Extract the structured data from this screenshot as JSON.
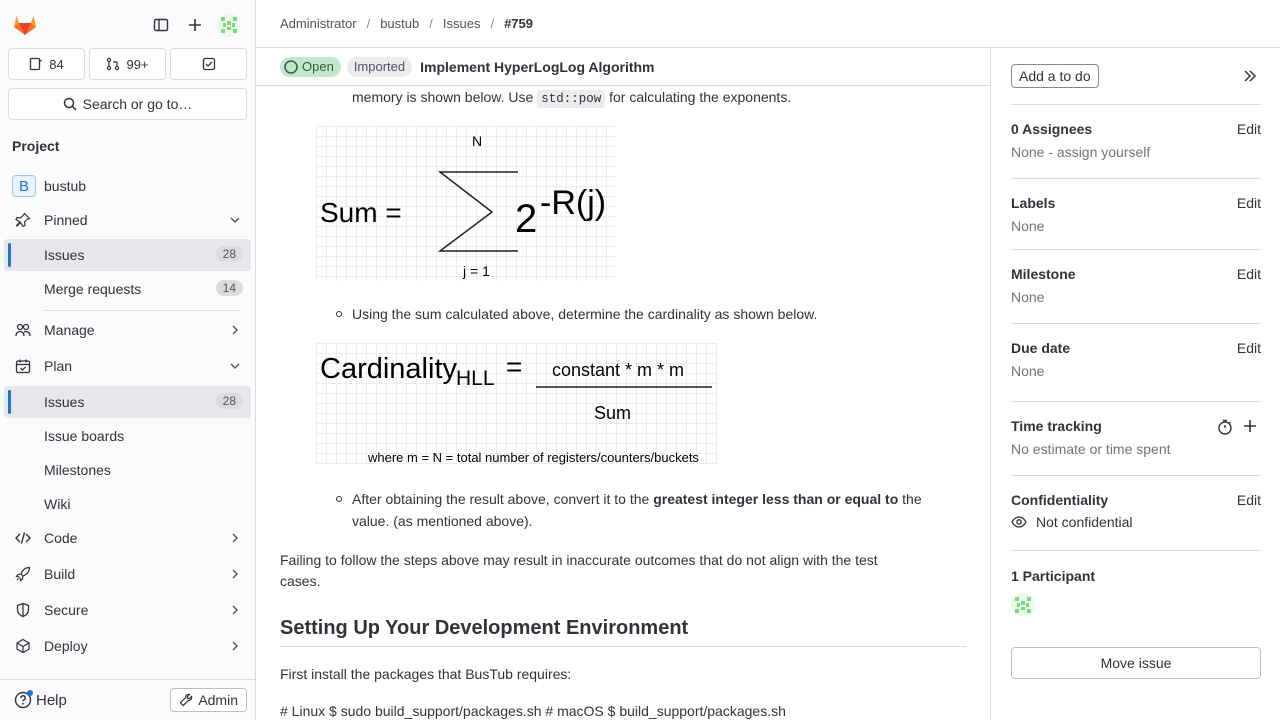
{
  "sidebar": {
    "counters": {
      "issues": "84",
      "merge_requests": "99+"
    },
    "search_label": "Search or go to…",
    "section_label": "Project",
    "project_initial": "B",
    "project_name": "bustub",
    "pinned_label": "Pinned",
    "pinned_items": [
      {
        "label": "Issues",
        "count": "28"
      },
      {
        "label": "Merge requests",
        "count": "14"
      }
    ],
    "manage_label": "Manage",
    "plan_label": "Plan",
    "plan_items": [
      {
        "label": "Issues",
        "count": "28"
      },
      {
        "label": "Issue boards"
      },
      {
        "label": "Milestones"
      },
      {
        "label": "Wiki"
      }
    ],
    "groups": [
      "Code",
      "Build",
      "Secure",
      "Deploy"
    ],
    "help_label": "Help",
    "admin_label": "Admin"
  },
  "breadcrumb": [
    "Administrator",
    "bustub",
    "Issues",
    "#759"
  ],
  "issue": {
    "status": "Open",
    "imported": "Imported",
    "title": "Implement HyperLogLog Algorithm"
  },
  "content": {
    "p1_pre": "memory is shown below. Use ",
    "p1_code": "std::pow",
    "p1_post": " for calculating the exponents.",
    "formula1": {
      "lhs": "Sum =",
      "top": "N",
      "bottom": "j = 1",
      "base": "2",
      "exp": "-R(j)"
    },
    "bullet1": "Using the sum calculated above, determine the cardinality as shown below.",
    "formula2": {
      "lhs": "Cardinality",
      "sub": "HLL",
      "eq": "=",
      "num": "constant * m * m",
      "den": "Sum",
      "note": "where m = N = total number of registers/counters/buckets"
    },
    "bullet2_pre": "After obtaining the result above, convert it to the ",
    "bullet2_bold": "greatest integer less than or equal to",
    "bullet2_post": " the",
    "bullet2_line2": "value. (as mentioned above).",
    "p2_line1": "Failing to follow the steps above may result in inaccurate outcomes that do not align with the test",
    "p2_line2": "cases.",
    "h2": "Setting Up Your Development Environment",
    "p3": "First install the packages that BusTub requires:",
    "p4": "# Linux $ sudo build_support/packages.sh # macOS $ build_support/packages.sh"
  },
  "right_sidebar": {
    "todo": "Add a to do",
    "assignees_title": "0 Assignees",
    "assignees_value": "None - assign yourself",
    "labels_title": "Labels",
    "labels_value": "None",
    "milestone_title": "Milestone",
    "milestone_value": "None",
    "due_title": "Due date",
    "due_value": "None",
    "time_title": "Time tracking",
    "time_value": "No estimate or time spent",
    "conf_title": "Confidentiality",
    "conf_value": "Not confidential",
    "participants_title": "1 Participant",
    "edit": "Edit",
    "move": "Move issue"
  }
}
